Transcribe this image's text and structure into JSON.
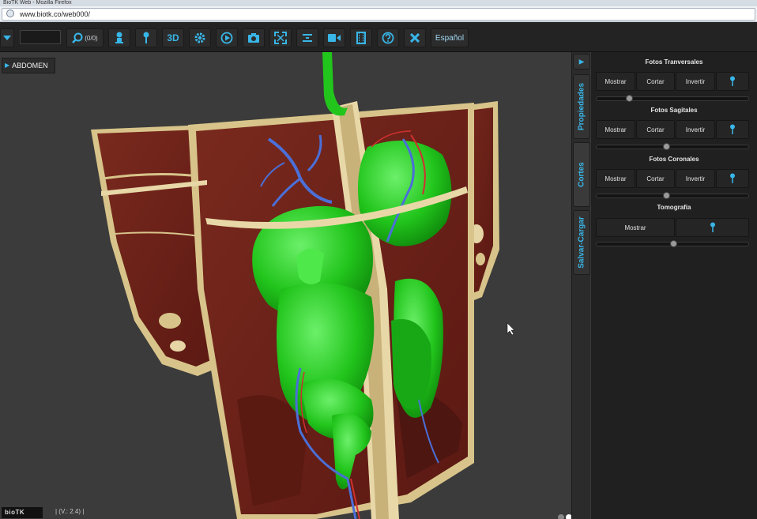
{
  "browser": {
    "window_title": "BioTK Web - Mozilla Firefox",
    "url": "www.biotk.co/web000/"
  },
  "toolbar": {
    "search_label": "(0/0)",
    "view_3d_label": "3D",
    "language_label": "Español"
  },
  "viewport": {
    "breadcrumb": "ABDOMEN",
    "colors": {
      "organs": "#22c51c",
      "muscle": "#6b2018",
      "fat": "#d8c48a",
      "veins": "#4b6fd8",
      "arteries": "#d03030"
    }
  },
  "footer": {
    "logo": "bioTK",
    "version": "| (V.: 2.4) |"
  },
  "side_tabs": [
    "Propiedades",
    "Cortes",
    "Salvar-Cargar"
  ],
  "panel": {
    "transversal": {
      "title": "Fotos Tranversales",
      "show": "Mostrar",
      "cut": "Cortar",
      "invert": "Invertir",
      "slider": 0.2
    },
    "sagital": {
      "title": "Fotos Sagitales",
      "show": "Mostrar",
      "cut": "Cortar",
      "invert": "Invertir",
      "slider": 0.46
    },
    "coronal": {
      "title": "Fotos Coronales",
      "show": "Mostrar",
      "cut": "Cortar",
      "invert": "Invertir",
      "slider": 0.46
    },
    "tomografia": {
      "title": "Tomografía",
      "show": "Mostrar",
      "slider": 0.51
    }
  },
  "accent_color": "#38b6e8"
}
